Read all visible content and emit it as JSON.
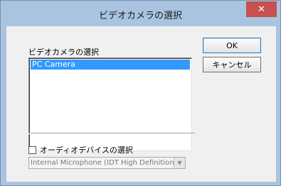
{
  "window": {
    "title": "ビデオカメラの選択",
    "close_glyph": "✕"
  },
  "camera": {
    "label": "ビデオカメラの選択",
    "items": [
      "PC Camera"
    ],
    "selected": "PC Camera"
  },
  "buttons": {
    "ok_label": "OK",
    "cancel_label": "キャンセル"
  },
  "audio": {
    "checkbox_label": "オーディオデバイスの選択",
    "checked": false,
    "device_value": "Internal Microphone (IDT High Definition",
    "dropdown_glyph": "▼"
  }
}
